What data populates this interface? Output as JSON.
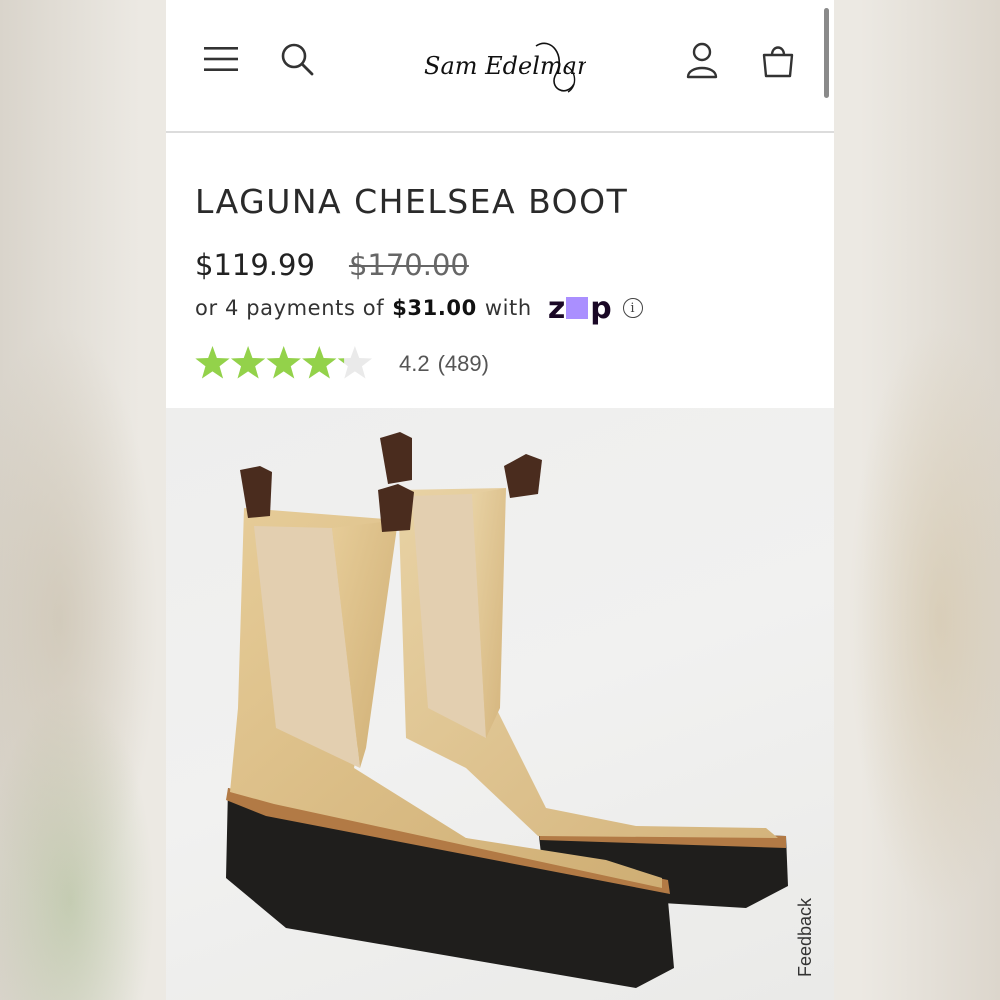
{
  "header": {
    "brand": "Sam Edelman",
    "icons": {
      "menu": "hamburger-menu-icon",
      "search": "search-icon",
      "account": "account-icon",
      "bag": "shopping-bag-icon"
    }
  },
  "product": {
    "title": "LAGUNA CHELSEA BOOT",
    "sale_price": "$119.99",
    "original_price": "$170.00",
    "installments": {
      "prefix": "or 4 payments of",
      "amount": "$31.00",
      "suffix": "with",
      "provider": "zip",
      "provider_colors": {
        "text": "#1a0826",
        "accent": "#aa8fff"
      }
    },
    "rating": {
      "value": 4.2,
      "display_value": "4.2",
      "count": "(489)",
      "max": 5,
      "star_color": "#93d24a",
      "empty_star_color": "#eaeaea"
    },
    "image": {
      "colors": {
        "leather": "#dcbf8a",
        "elastic": "#e3cfb0",
        "pull_tab": "#4a2c1e",
        "sole": "#1f1e1c",
        "welt": "#b27a45"
      }
    }
  },
  "feedback": {
    "label": "Feedback"
  }
}
